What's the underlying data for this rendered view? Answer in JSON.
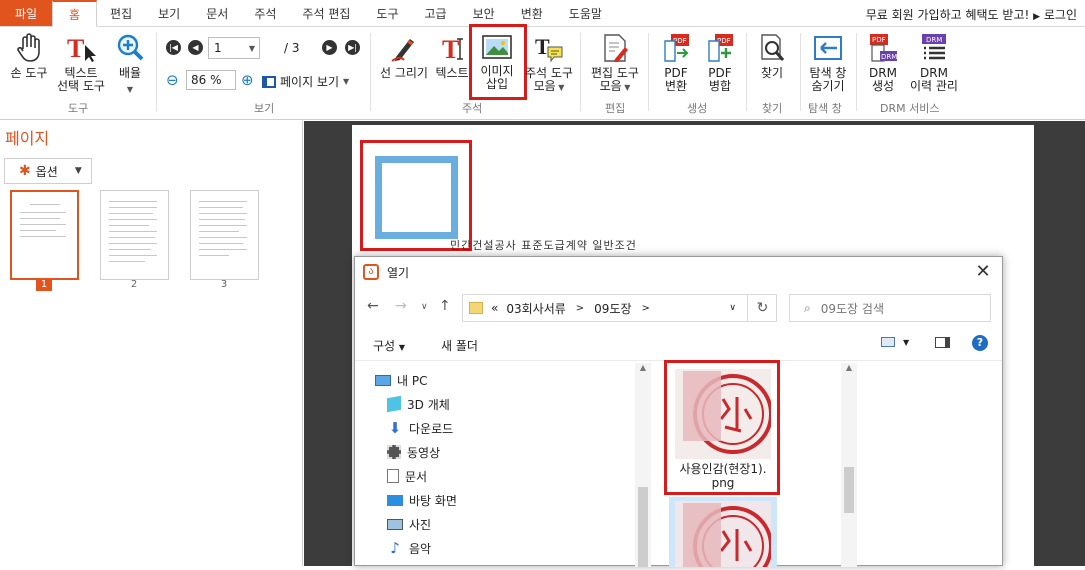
{
  "menubar": {
    "file": "파일",
    "tabs": [
      "홈",
      "편집",
      "보기",
      "문서",
      "주석",
      "주석 편집",
      "도구",
      "고급",
      "보안",
      "변환",
      "도움말"
    ],
    "active_tab": "홈",
    "promo": "무료 회원 가입하고 혜택도 받고!",
    "login": "로그인"
  },
  "ribbon": {
    "hand_tool": "손 도구",
    "text_select_1": "텍스트",
    "text_select_2": "선택 도구",
    "zoom": "배율",
    "group_tools": "도구",
    "page_value": "1",
    "page_total": "/ 3",
    "zoom_value": "86 %",
    "page_view": "페이지 보기",
    "group_view": "보기",
    "draw_line": "선 그리기",
    "text": "텍스트",
    "insert_image_1": "이미지",
    "insert_image_2": "삽입",
    "comment_tools_1": "주석 도구",
    "comment_tools_2": "모음",
    "group_comment": "주석",
    "edit_tools_1": "편집 도구",
    "edit_tools_2": "모음",
    "group_edit": "편집",
    "pdf_convert_1": "PDF",
    "pdf_convert_2": "변환",
    "pdf_merge_1": "PDF",
    "pdf_merge_2": "병합",
    "group_create": "생성",
    "find": "찾기",
    "group_find": "찾기",
    "hide_nav_1": "탐색 창",
    "hide_nav_2": "숨기기",
    "group_nav": "탐색 창",
    "drm_create_1": "DRM",
    "drm_create_2": "생성",
    "drm_history_1": "DRM",
    "drm_history_2": "이력 관리",
    "group_drm": "DRM 서비스",
    "pdf_badge": "PDF",
    "drm_badge": "DRM"
  },
  "leftpanel": {
    "title": "페이지",
    "options": "옵션",
    "pages": [
      "1",
      "2",
      "3"
    ]
  },
  "document": {
    "title": "민간건설공사 표준도급계약 일반조건"
  },
  "dialog": {
    "title": "열기",
    "path": [
      "03회사서류",
      "09도장"
    ],
    "search_placeholder": "09도장 검색",
    "organize": "구성",
    "new_folder": "새 폴더",
    "tree": [
      "내 PC",
      "3D 개체",
      "다운로드",
      "동영상",
      "문서",
      "바탕 화면",
      "사진",
      "음악"
    ],
    "file1_name": "사용인감(현장1).png"
  },
  "colors": {
    "accent": "#e2541e",
    "highlight": "#d91a1a",
    "placeholder_blue": "#6aaee0"
  }
}
